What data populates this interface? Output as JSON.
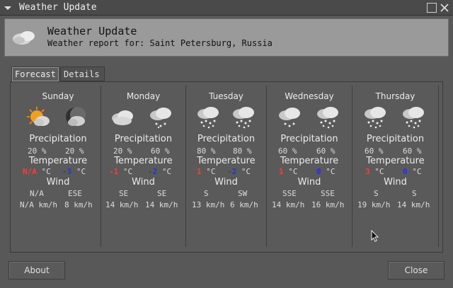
{
  "window": {
    "title": "Weather Update"
  },
  "header": {
    "title": "Weather Update",
    "subtitle": "Weather report for: Saint Petersburg, Russia"
  },
  "tabs": [
    {
      "label": "Forecast",
      "active": true
    },
    {
      "label": "Details",
      "active": false
    }
  ],
  "labels": {
    "precipitation": "Precipitation",
    "temperature": "Temperature",
    "wind": "Wind"
  },
  "days": [
    {
      "name": "Sunday",
      "icons": [
        "partly-sunny-icon",
        "night-cloudy-icon"
      ],
      "precip": [
        "20 %",
        "20 %"
      ],
      "temp_hi": "N/A",
      "temp_lo": "-3",
      "unit": "°C",
      "wind_dir": [
        "N/A",
        "ESE"
      ],
      "wind_speed": [
        "N/A km/h",
        "8 km/h"
      ]
    },
    {
      "name": "Monday",
      "icons": [
        "cloudy-icon",
        "cloud-snow-icon"
      ],
      "precip": [
        "20 %",
        "60 %"
      ],
      "temp_hi": "-1",
      "temp_lo": "-2",
      "unit": "°C",
      "wind_dir": [
        "SE",
        "SE"
      ],
      "wind_speed": [
        "14 km/h",
        "14 km/h"
      ]
    },
    {
      "name": "Tuesday",
      "icons": [
        "snow-icon",
        "snow-icon"
      ],
      "precip": [
        "80 %",
        "80 %"
      ],
      "temp_hi": "1",
      "temp_lo": "-2",
      "unit": "°C",
      "wind_dir": [
        "S",
        "SW"
      ],
      "wind_speed": [
        "13 km/h",
        "6 km/h"
      ]
    },
    {
      "name": "Wednesday",
      "icons": [
        "cloud-snow-icon",
        "snow-icon"
      ],
      "precip": [
        "60 %",
        "60 %"
      ],
      "temp_hi": "1",
      "temp_lo": "0",
      "unit": "°C",
      "wind_dir": [
        "SSE",
        "SSE"
      ],
      "wind_speed": [
        "14 km/h",
        "16 km/h"
      ]
    },
    {
      "name": "Thursday",
      "icons": [
        "snow-icon",
        "snow-icon"
      ],
      "precip": [
        "60 %",
        "60 %"
      ],
      "temp_hi": "3",
      "temp_lo": "0",
      "unit": "°C",
      "wind_dir": [
        "S",
        "S"
      ],
      "wind_speed": [
        "19 km/h",
        "14 km/h"
      ]
    }
  ],
  "buttons": {
    "about": "About",
    "close": "Close"
  },
  "colors": {
    "temp_high": "#ff3a3a",
    "temp_low": "#2a2aff"
  }
}
